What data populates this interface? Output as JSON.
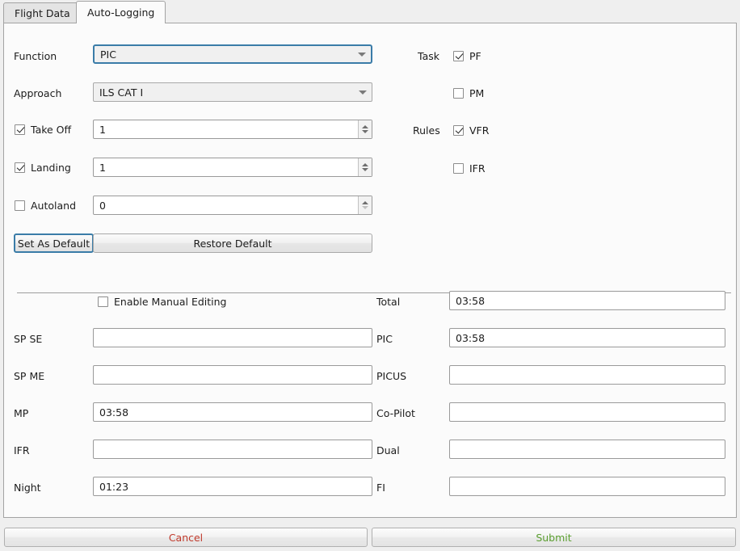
{
  "tabs": [
    {
      "label": "Flight Data",
      "active": false
    },
    {
      "label": "Auto-Logging",
      "active": true
    }
  ],
  "form": {
    "function": {
      "label": "Function",
      "value": "PIC",
      "focused": true
    },
    "approach": {
      "label": "Approach",
      "value": "ILS CAT I",
      "focused": false
    },
    "take_off": {
      "label": "Take Off",
      "checked": true,
      "value": "1"
    },
    "landing": {
      "label": "Landing",
      "checked": true,
      "value": "1"
    },
    "autoland": {
      "label": "Autoland",
      "checked": false,
      "value": "0"
    },
    "task": {
      "label": "Task",
      "options": [
        {
          "label": "PF",
          "checked": true
        },
        {
          "label": "PM",
          "checked": false
        }
      ]
    },
    "rules": {
      "label": "Rules",
      "options": [
        {
          "label": "VFR",
          "checked": true
        },
        {
          "label": "IFR",
          "checked": false
        }
      ]
    },
    "set_as_default": "Set As Default",
    "restore_default": "Restore Default"
  },
  "times": {
    "enable_manual_editing": {
      "label": "Enable Manual Editing",
      "checked": false
    },
    "left": [
      {
        "label": "SP SE",
        "value": ""
      },
      {
        "label": "SP ME",
        "value": ""
      },
      {
        "label": "MP",
        "value": "03:58"
      },
      {
        "label": "IFR",
        "value": ""
      },
      {
        "label": "Night",
        "value": "01:23"
      }
    ],
    "right": [
      {
        "label": "Total",
        "value": "03:58"
      },
      {
        "label": "PIC",
        "value": "03:58"
      },
      {
        "label": "PICUS",
        "value": ""
      },
      {
        "label": "Co-Pilot",
        "value": ""
      },
      {
        "label": "Dual",
        "value": ""
      },
      {
        "label": "FI",
        "value": ""
      }
    ]
  },
  "footer": {
    "cancel": "Cancel",
    "submit": "Submit",
    "cancel_color": "#c0392b",
    "submit_color": "#5a9e2f"
  }
}
